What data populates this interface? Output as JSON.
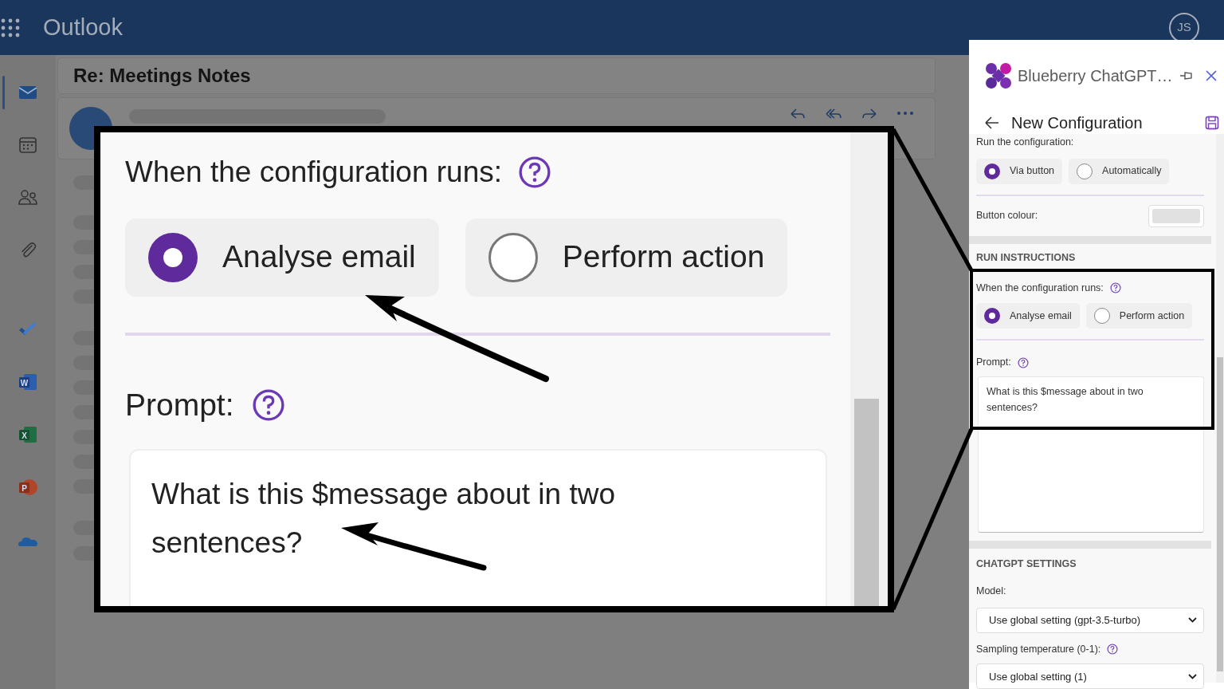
{
  "app": {
    "title": "Outlook",
    "avatar_initials": "JS"
  },
  "rail": [
    {
      "kind": "mail",
      "selected": true
    },
    {
      "kind": "calendar",
      "selected": false
    },
    {
      "kind": "people",
      "selected": false
    },
    {
      "kind": "attachment",
      "selected": false
    },
    {
      "kind": "todo",
      "selected": false
    },
    {
      "kind": "word",
      "selected": false,
      "letter": "W"
    },
    {
      "kind": "excel",
      "selected": false,
      "letter": "X"
    },
    {
      "kind": "powerpoint",
      "selected": false,
      "letter": "P"
    },
    {
      "kind": "onedrive",
      "selected": false
    }
  ],
  "message": {
    "subject": "Re: Meetings Notes"
  },
  "panel": {
    "title": "Blueberry ChatGPT…",
    "heading": "New Configuration",
    "run_label": "Run the configuration:",
    "run_options": [
      {
        "label": "Via button",
        "selected": true
      },
      {
        "label": "Automatically",
        "selected": false
      }
    ],
    "button_colour_label": "Button colour:",
    "run_instructions_heading": "RUN INSTRUCTIONS",
    "when_label": "When the configuration runs:",
    "when_options": [
      {
        "label": "Analyse email",
        "selected": true
      },
      {
        "label": "Perform action",
        "selected": false
      }
    ],
    "prompt_label": "Prompt:",
    "prompt_value": "What is this $message about in two sentences?",
    "chatgpt_heading": "CHATGPT SETTINGS",
    "model": {
      "label": "Model:",
      "value": "Use global setting (gpt-3.5-turbo)"
    },
    "temperature": {
      "label": "Sampling temperature (0-1):",
      "value": "Use global setting (1)"
    }
  },
  "callout": {
    "when_label": "When the configuration runs:",
    "options": [
      {
        "label": "Analyse email",
        "selected": true
      },
      {
        "label": "Perform action",
        "selected": false
      }
    ],
    "prompt_label": "Prompt:",
    "prompt_value": "What is this $message about in two sentences?"
  }
}
